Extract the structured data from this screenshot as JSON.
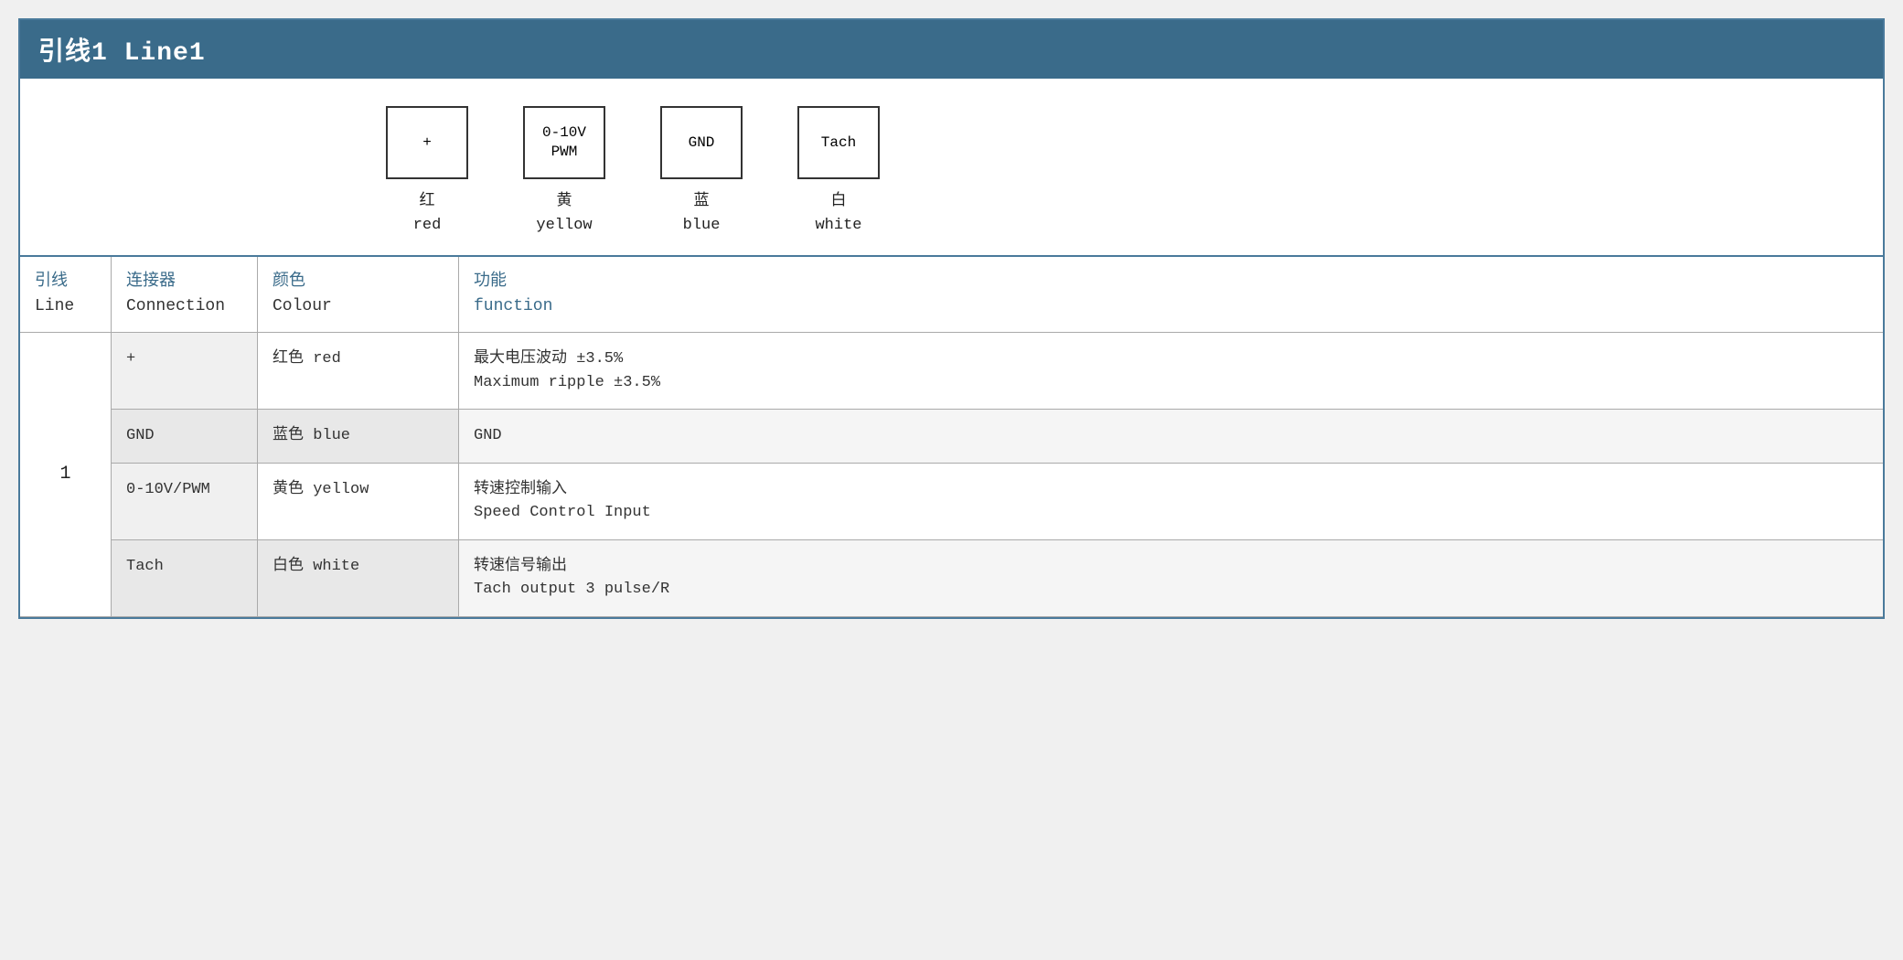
{
  "title": "引线1 Line1",
  "diagram": {
    "pins": [
      {
        "symbol": "+",
        "cn": "红",
        "en": "red"
      },
      {
        "symbol": "0-10V\nPWM",
        "cn": "黄",
        "en": "yellow"
      },
      {
        "symbol": "GND",
        "cn": "蓝",
        "en": "blue"
      },
      {
        "symbol": "Tach",
        "cn": "白",
        "en": "white"
      }
    ]
  },
  "table": {
    "header": {
      "line_cn": "引线",
      "line_en": "Line",
      "connection_cn": "连接器",
      "connection_en": "Connection",
      "colour_cn": "颜色",
      "colour_en": "Colour",
      "function_cn": "功能",
      "function_en": "function"
    },
    "rows": [
      {
        "line": "1",
        "sub_rows": [
          {
            "connection": "+",
            "colour_cn": "红色",
            "colour_en": "red",
            "function_cn": "最大电压波动 ±3.5%",
            "function_en": "Maximum ripple ±3.5%",
            "bg": "white"
          },
          {
            "connection": "GND",
            "colour_cn": "蓝色",
            "colour_en": "blue",
            "function_cn": "GND",
            "function_en": "",
            "bg": "light"
          },
          {
            "connection": "0-10V/PWM",
            "colour_cn": "黄色",
            "colour_en": "yellow",
            "function_cn": "转速控制输入",
            "function_en": "Speed Control Input",
            "bg": "white"
          },
          {
            "connection": "Tach",
            "colour_cn": "白色",
            "colour_en": "white",
            "function_cn": "转速信号输出",
            "function_en": "Tach output 3 pulse/R",
            "bg": "light"
          }
        ]
      }
    ]
  }
}
